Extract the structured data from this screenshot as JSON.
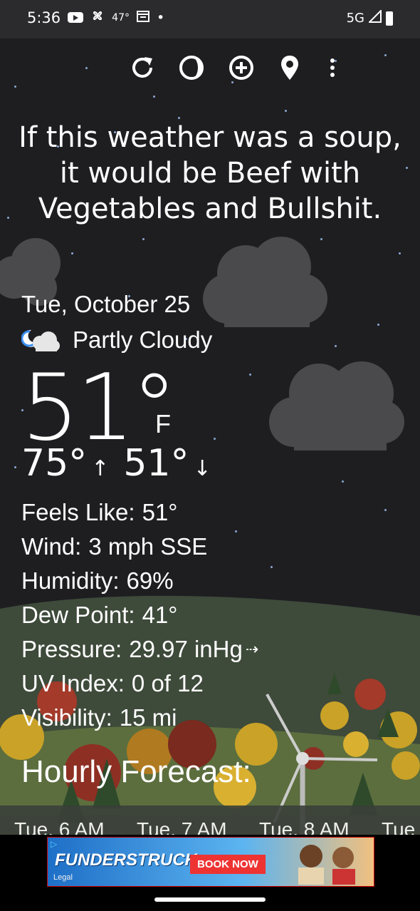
{
  "status_bar": {
    "time": "5:36",
    "temp": "47°",
    "network": "5G",
    "dot": "•"
  },
  "toolbar": {
    "refresh": "refresh-icon",
    "theme": "theme-icon",
    "add": "add-location-icon",
    "location": "location-pin-icon",
    "menu": "more-vert-icon"
  },
  "headline": "If this weather was a soup, it would be Beef with Vegetables and Bullshit.",
  "current": {
    "date": "Tue, October 25",
    "condition": "Partly Cloudy",
    "temperature": "51°",
    "unit": "F",
    "high": "75°",
    "low": "51°",
    "high_arrow": "↑",
    "low_arrow": "↓"
  },
  "details": [
    {
      "label": "Feels Like:",
      "value": "51°"
    },
    {
      "label": "Wind:",
      "value": "3 mph SSE"
    },
    {
      "label": "Humidity:",
      "value": "69%"
    },
    {
      "label": "Dew Point:",
      "value": "41°"
    },
    {
      "label": "Pressure:",
      "value": "29.97 inHg",
      "suffix": "⇢"
    },
    {
      "label": "UV Index:",
      "value": "0 of 12"
    },
    {
      "label": "Visibility:",
      "value": "15 mi"
    }
  ],
  "hourly": {
    "title": "Hourly Forecast:",
    "hours": [
      "Tue, 6 AM",
      "Tue, 7 AM",
      "Tue, 8 AM",
      "Tue"
    ]
  },
  "ad": {
    "brand": "FUNDERSTRUCK",
    "cta": "BOOK NOW",
    "legal": "Legal"
  },
  "colors": {
    "sky": "#1e1e21",
    "hills": "#4a5a3e",
    "star": "#9fc0f0"
  }
}
